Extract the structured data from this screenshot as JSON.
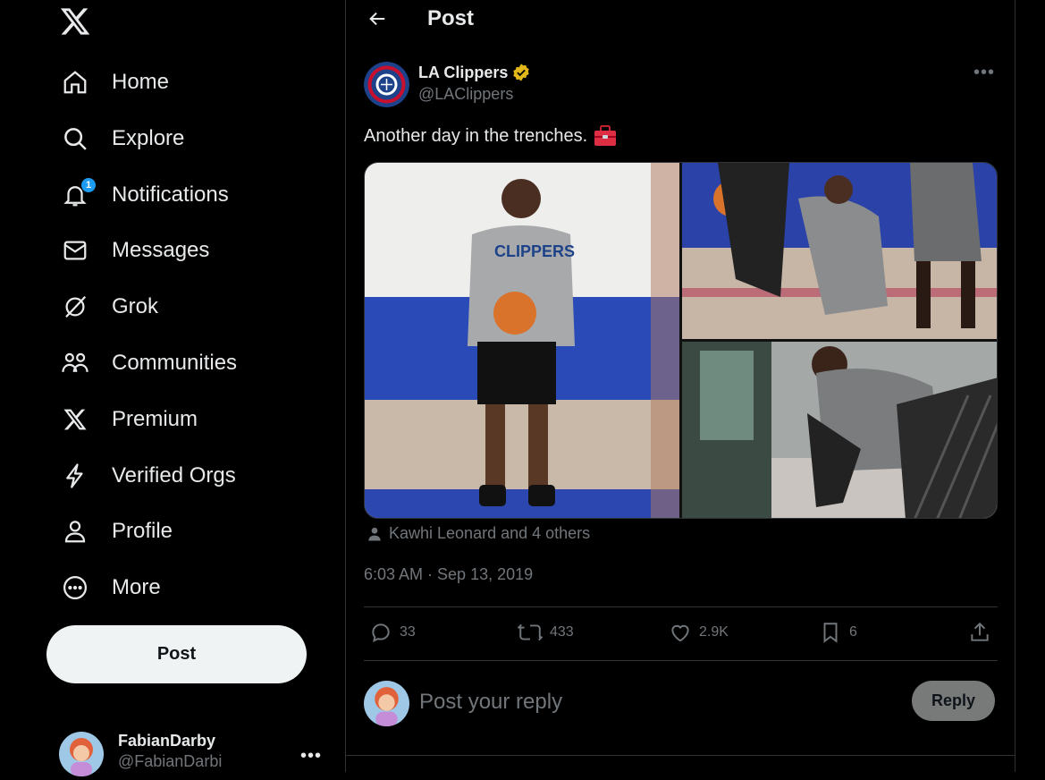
{
  "sidebar": {
    "items": [
      {
        "label": "Home",
        "icon": "home-icon"
      },
      {
        "label": "Explore",
        "icon": "search-icon"
      },
      {
        "label": "Notifications",
        "icon": "bell-icon",
        "badge": "1"
      },
      {
        "label": "Messages",
        "icon": "envelope-icon"
      },
      {
        "label": "Grok",
        "icon": "grok-icon"
      },
      {
        "label": "Communities",
        "icon": "communities-icon"
      },
      {
        "label": "Premium",
        "icon": "x-logo-icon"
      },
      {
        "label": "Verified Orgs",
        "icon": "lightning-icon"
      },
      {
        "label": "Profile",
        "icon": "person-icon"
      },
      {
        "label": "More",
        "icon": "more-circle-icon"
      }
    ],
    "post_label": "Post",
    "account": {
      "name": "FabianDarby",
      "handle": "@FabianDarbi"
    }
  },
  "header": {
    "title": "Post"
  },
  "tweet": {
    "author_name": "LA Clippers",
    "author_handle": "@LAClippers",
    "text": "Another day in the trenches.",
    "tagged": "Kawhi Leonard and 4 others",
    "timestamp": "6:03 AM · Sep 13, 2019",
    "stats": {
      "replies": "33",
      "reposts": "433",
      "likes": "2.9K",
      "bookmarks": "6"
    }
  },
  "reply": {
    "placeholder": "Post your reply",
    "button_label": "Reply"
  },
  "colors": {
    "background": "#000000",
    "text": "#e7e9ea",
    "muted": "#71767b",
    "accent": "#1d9bf0",
    "border": "#2f3336",
    "verified_gold": "#e2b719"
  }
}
